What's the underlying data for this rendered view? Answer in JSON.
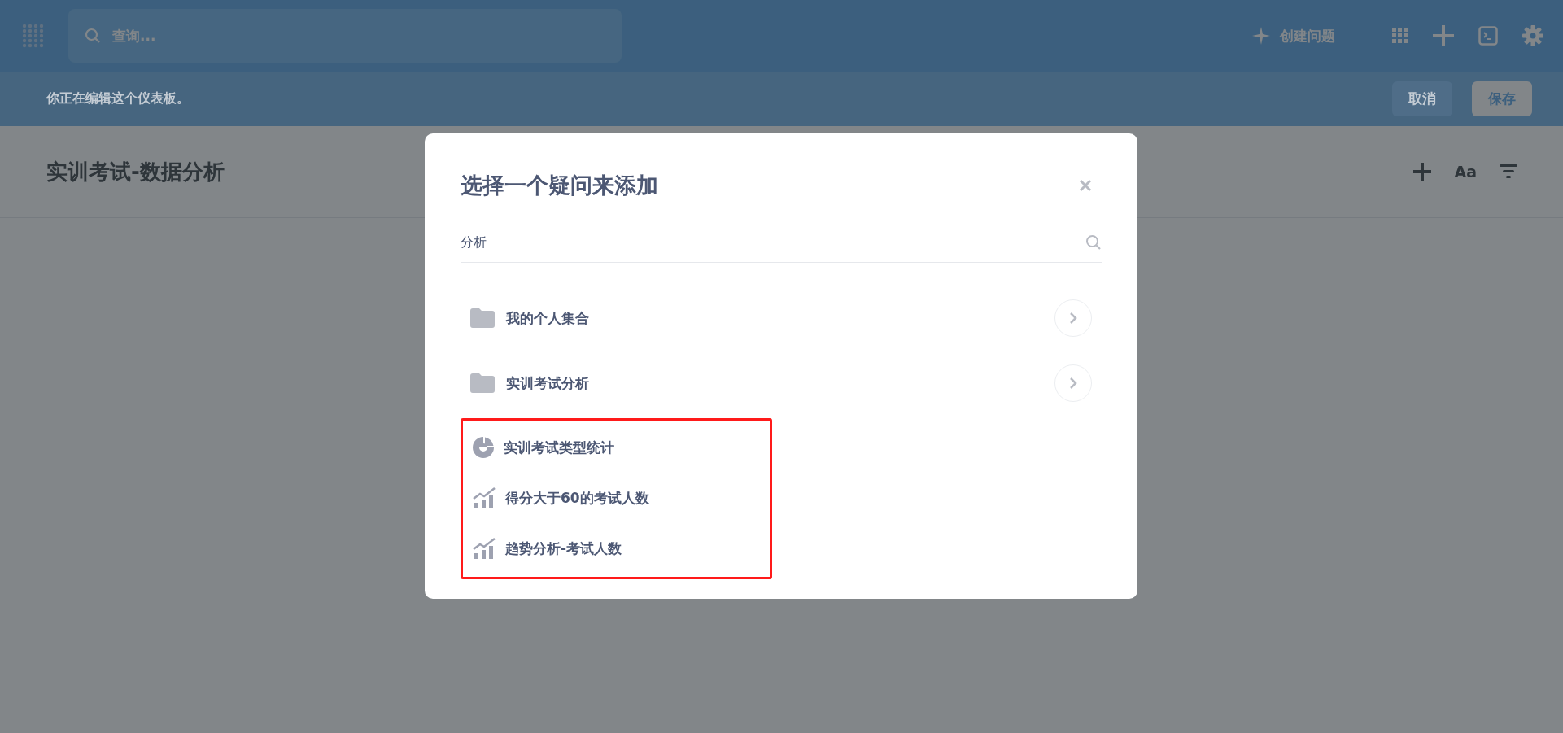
{
  "top_bar": {
    "search": {
      "placeholder": "查询..."
    },
    "create_question": "创建问题"
  },
  "edit_banner": {
    "message": "你正在编辑这个仪表板。",
    "buttons": [
      {
        "label": "取消",
        "kind": "secondary"
      },
      {
        "label": "保存",
        "kind": "primary"
      }
    ]
  },
  "dashboard": {
    "title": "实训考试-数据分析",
    "format_button": "Aa"
  },
  "modal": {
    "title": "选择一个疑问来添加",
    "search": {
      "value": "分析"
    },
    "collections": [
      {
        "name": "我的个人集合"
      },
      {
        "name": "实训考试分析"
      }
    ],
    "questions": [
      {
        "name": "实训考试类型统计",
        "kind": "pie"
      },
      {
        "name": "得分大于60的考试人数",
        "kind": "line"
      },
      {
        "name": "趋势分析-考试人数",
        "kind": "line"
      }
    ],
    "questions_highlighted": true
  }
}
